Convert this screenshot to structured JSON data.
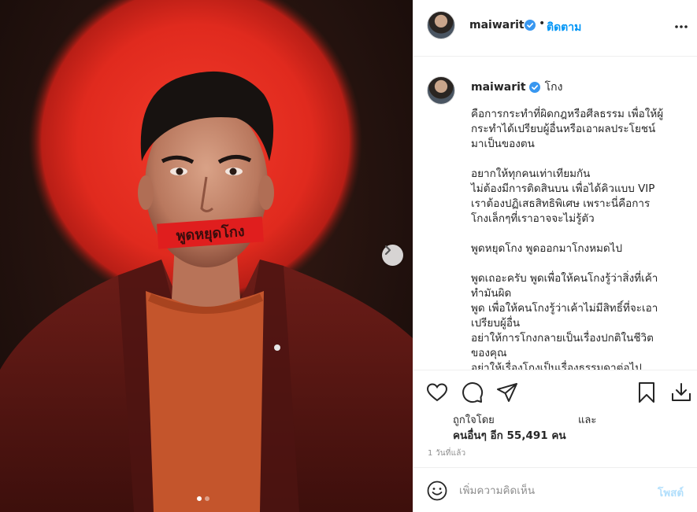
{
  "post": {
    "image": {
      "mouth_tape_text": "พูดหยุดโกง",
      "carousel": {
        "count": 2,
        "active": 1
      },
      "colors": {
        "spotlight": "#e8281d",
        "jacket": "#5e1a16",
        "sweater": "#c4552c",
        "tape": "#e01e1e"
      }
    },
    "header": {
      "username": "maiwarit",
      "follow_label": "ติดตาม",
      "separator": "•"
    },
    "caption": {
      "username": "maiwarit",
      "first_line": "โกง",
      "lines": [
        "คือการกระทำที่ผิดกฎหรือศีลธรรม เพื่อให้ผู้",
        "กระทำได้เปรียบผู้อื่นหรือเอาผลประโยชน์",
        "มาเป็นของตน",
        "",
        "อยากให้ทุกคนเท่าเทียมกัน",
        "ไม่ต้องมีการติดสินบน เพื่อได้คิวแบบ VIP",
        "เราต้องปฏิเสธสิทธิพิเศษ เพราะนี่คือการ",
        "โกงเล็กๆที่เราอาจจะไม่รู้ตัว",
        "",
        "พูดหยุดโกง พูดออกมาโกงหมดไป",
        "",
        "พูดเถอะครับ พูดเพื่อให้คนโกงรู้ว่าสิ่งที่เค้า",
        "ทำมันผิด",
        "พูด เพื่อให้คนโกงรู้ว่าเค้าไม่มีสิทธิ์ที่จะเอา",
        "เปรียบผู้อื่น",
        "อย่าให้การโกงกลายเป็นเรื่องปกติในชีวิต",
        "ของคุณ",
        "อย่าให้เรื่องโกงเป็นเรื่องธรรมดาต่อไป"
      ]
    },
    "likes": {
      "liked_by_label": "ถูกใจโดย",
      "and_label": "และ",
      "others_label": "คนอื่นๆ อีก 55,491 คน"
    },
    "timestamp": "1 วันที่แล้ว",
    "comment": {
      "placeholder": "เพิ่มความคิดเห็น",
      "post_label": "โพสต์"
    },
    "icons": {
      "like": "heart-icon",
      "comment": "comment-bubble-icon",
      "share": "paper-plane-icon",
      "save": "bookmark-icon",
      "download": "download-icon",
      "emoji": "smiley-icon",
      "more": "more-horizontal-icon",
      "verified": "verified-badge-icon",
      "next": "chevron-right-icon"
    },
    "accent_colors": {
      "link": "#0095f6",
      "post_disabled": "#b2dffc",
      "verified": "#3897f0"
    }
  }
}
